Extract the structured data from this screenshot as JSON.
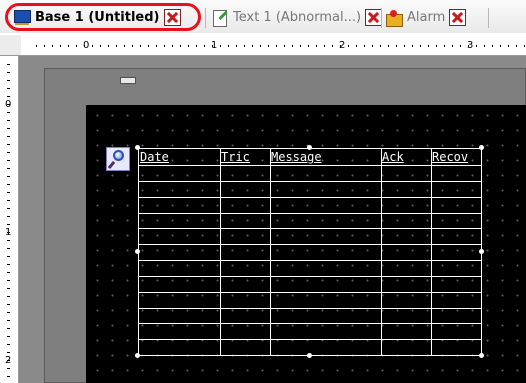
{
  "tabs": [
    {
      "label": "Base 1 (Untitled)",
      "icon": "base-screen-icon",
      "active": true
    },
    {
      "label": "Text 1 (Abnormal...)",
      "icon": "text-screen-icon",
      "active": false
    },
    {
      "label": "Alarm",
      "icon": "alarm-screen-icon",
      "active": false
    }
  ],
  "ruler": {
    "horizontal": [
      "0",
      "1",
      "2",
      "3"
    ],
    "vertical": [
      "0",
      "1",
      "2"
    ]
  },
  "alarm_table": {
    "columns": [
      "Date",
      "Tric",
      "Message",
      "Ack",
      "Recov"
    ],
    "row_count": 12
  },
  "colors": {
    "highlight_ring": "#e8101c",
    "close_button": "#c81c1c",
    "screen_background": "#000000",
    "table_lines": "#ffffff"
  }
}
